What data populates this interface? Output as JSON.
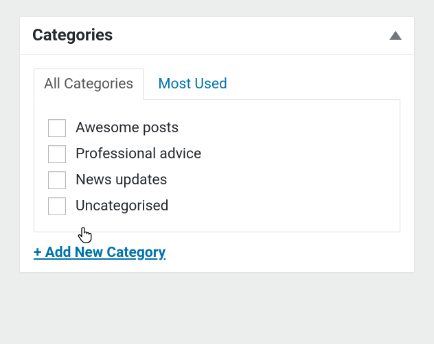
{
  "panel": {
    "title": "Categories"
  },
  "tabs": {
    "all": "All Categories",
    "most_used": "Most Used"
  },
  "categories": [
    {
      "label": "Awesome posts",
      "checked": false
    },
    {
      "label": "Professional advice",
      "checked": false
    },
    {
      "label": "News updates",
      "checked": false
    },
    {
      "label": "Uncategorised",
      "checked": false
    }
  ],
  "add_new_label": "+ Add New Category"
}
